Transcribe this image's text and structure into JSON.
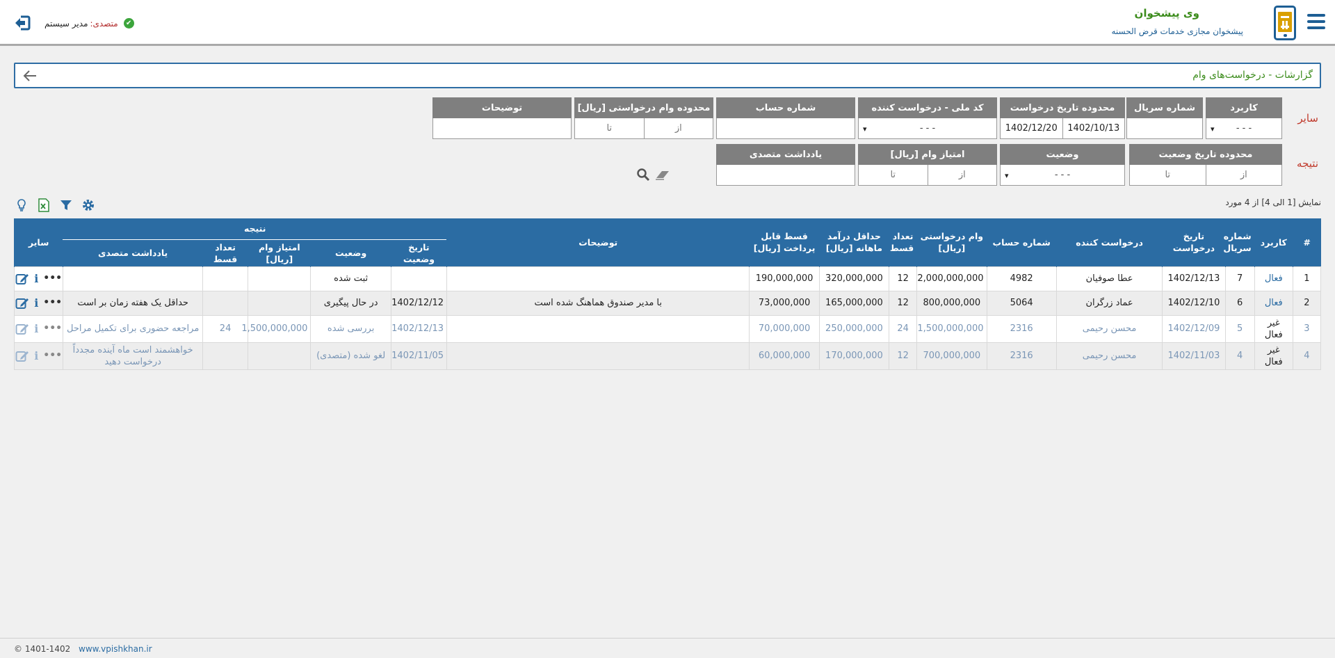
{
  "header": {
    "brand_title": "وی پیشخوان",
    "brand_subtitle": "پیشخوان مجازی خدمات قرض الحسنه",
    "user_role_label": "متصدی:",
    "user_name": "مدیر سیستم"
  },
  "page": {
    "title": "گزارشات - درخواست‌های وام"
  },
  "filters": {
    "section_other": "سایر",
    "section_result": "نتیجه",
    "user_type": {
      "label": "کاربرد",
      "value": "- - -"
    },
    "serial": {
      "label": "شماره سریال",
      "value": ""
    },
    "request_date_range": {
      "label": "محدوده تاریخ درخواست",
      "from": "1402/10/13",
      "to": "1402/12/20"
    },
    "national_code": {
      "label": "کد ملی - درخواست کننده",
      "value": "- - -"
    },
    "account_number": {
      "label": "شماره حساب",
      "value": ""
    },
    "loan_range": {
      "label": "محدوده وام درخواستی [ریال]",
      "from": "از",
      "to": "تا"
    },
    "description": {
      "label": "توضیحات",
      "value": ""
    },
    "status_date_range": {
      "label": "محدوده تاریخ وضعیت",
      "from": "از",
      "to": "تا"
    },
    "status": {
      "label": "وضعیت",
      "value": "- - -"
    },
    "loan_score": {
      "label": "امتیاز وام [ریال]",
      "from": "از",
      "to": "تا"
    },
    "operator_note": {
      "label": "یادداشت متصدی",
      "value": ""
    }
  },
  "table": {
    "summary": "نمایش [1 الی 4] از 4 مورد",
    "headers": {
      "index": "#",
      "user_type": "کاربرد",
      "serial": "شماره سریال",
      "request_date": "تاریخ درخواست",
      "requester": "درخواست کننده",
      "account": "شماره حساب",
      "requested_loan": "وام درخواستی [ریال]",
      "installments": "تعداد قسط",
      "min_income": "حداقل درآمد ماهانه [ریال]",
      "payable_installment": "قسط قابل پرداخت [ریال]",
      "description": "توضیحات",
      "result_group": "نتیجه",
      "status_date": "تاریخ وضعیت",
      "status": "وضعیت",
      "loan_score": "امتیاز وام [ریال]",
      "result_installments": "تعداد قسط",
      "operator_note": "یادداشت متصدی",
      "other": "سایر"
    },
    "rows": [
      {
        "index": "1",
        "user_type": "فعال",
        "serial": "7",
        "request_date": "1402/12/13",
        "requester": "عطا صوفیان",
        "account": "4982",
        "requested_loan": "2,000,000,000",
        "installments": "12",
        "min_income": "320,000,000",
        "payable_installment": "190,000,000",
        "description": "",
        "status_date": "",
        "status": "ثبت شده",
        "loan_score": "",
        "result_installments": "",
        "operator_note": "",
        "active": true
      },
      {
        "index": "2",
        "user_type": "فعال",
        "serial": "6",
        "request_date": "1402/12/10",
        "requester": "عماد زرگران",
        "account": "5064",
        "requested_loan": "800,000,000",
        "installments": "12",
        "min_income": "165,000,000",
        "payable_installment": "73,000,000",
        "description": "با مدیر صندوق هماهنگ شده است",
        "status_date": "1402/12/12",
        "status": "در حال پیگیری",
        "loan_score": "",
        "result_installments": "",
        "operator_note": "حداقل یک هفته زمان بر است",
        "active": true
      },
      {
        "index": "3",
        "user_type": "غیر فعال",
        "serial": "5",
        "request_date": "1402/12/09",
        "requester": "محسن رحیمی",
        "account": "2316",
        "requested_loan": "1,500,000,000",
        "installments": "24",
        "min_income": "250,000,000",
        "payable_installment": "70,000,000",
        "description": "",
        "status_date": "1402/12/13",
        "status": "بررسی شده",
        "loan_score": "1,500,000,000",
        "result_installments": "24",
        "operator_note": "مراجعه حضوری برای تکمیل مراحل",
        "active": false
      },
      {
        "index": "4",
        "user_type": "غیر فعال",
        "serial": "4",
        "request_date": "1402/11/03",
        "requester": "محسن رحیمی",
        "account": "2316",
        "requested_loan": "700,000,000",
        "installments": "12",
        "min_income": "170,000,000",
        "payable_installment": "60,000,000",
        "description": "",
        "status_date": "1402/11/05",
        "status": "لغو شده (متصدی)",
        "loan_score": "",
        "result_installments": "",
        "operator_note": "خواهشمند است ماه آینده مجدداً درخواست دهید",
        "active": false
      }
    ]
  },
  "footer": {
    "copyright": "© 1401-1402",
    "site": "www.vpishkhan.ir"
  },
  "icons": {
    "menu": "hamburger-icon",
    "logo": "phone-bank-icon",
    "verified": "check-circle-icon",
    "logout": "logout-icon",
    "back": "arrow-left-icon",
    "search": "search-icon",
    "clear": "eraser-icon",
    "settings": "gear-icon",
    "filter": "filter-icon",
    "excel": "excel-icon",
    "hint": "lightbulb-icon"
  },
  "colors": {
    "primary": "#2b6ca3",
    "brand_green": "#3c8c1c",
    "label_red": "#c0392b",
    "filter_header": "#7f7f7f"
  }
}
